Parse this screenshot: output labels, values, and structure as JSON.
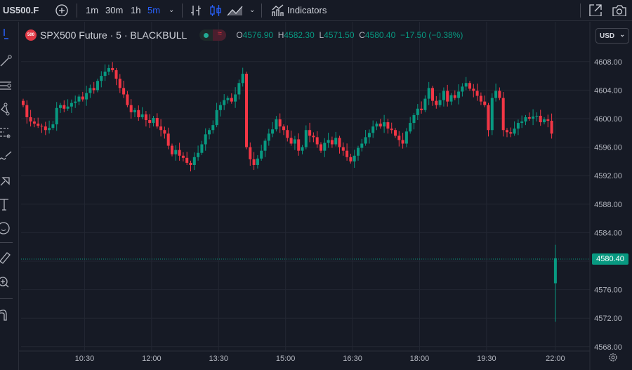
{
  "toolbar": {
    "symbol": "US500.F",
    "intervals": [
      "1m",
      "30m",
      "1h",
      "5m"
    ],
    "active_interval": "5m",
    "indicators_label": "Indicators"
  },
  "legend": {
    "title": "SPX500 Future · 5 · BLACKBULL",
    "badge": "500",
    "open_label": "O",
    "open": "4576.90",
    "high_label": "H",
    "high": "4582.30",
    "low_label": "L",
    "low": "4571.50",
    "close_label": "C",
    "close": "4580.40",
    "change": "−17.50 (−0.38%)"
  },
  "currency": "USD",
  "last_price_label": "4580.40",
  "colors": {
    "up": "#089981",
    "down": "#f23645",
    "bg": "#161a25",
    "grid": "#232733",
    "accent": "#2962ff"
  },
  "chart_data": {
    "type": "candlestick",
    "price_ticks": [
      "4608.00",
      "4604.00",
      "4600.00",
      "4596.00",
      "4592.00",
      "4588.00",
      "4584.00",
      "4580.00",
      "4576.00",
      "4572.00",
      "4568.00"
    ],
    "time_ticks": [
      {
        "label": "10:30",
        "bar": 16.5
      },
      {
        "label": "12:00",
        "bar": 34.5
      },
      {
        "label": "13:30",
        "bar": 52.5
      },
      {
        "label": "15:00",
        "bar": 70.5
      },
      {
        "label": "16:30",
        "bar": 88.5
      },
      {
        "label": "18:00",
        "bar": 106.5
      },
      {
        "label": "19:30",
        "bar": 124.5
      },
      {
        "label": "22:00",
        "bar": 143
      }
    ],
    "closes": [
      4601.9,
      4600.2,
      4599.6,
      4599.3,
      4599.0,
      4598.9,
      4598.4,
      4598.7,
      4599.2,
      4601.5,
      4601.9,
      4601.4,
      4601.7,
      4602.2,
      4602.4,
      4603.1,
      4602.7,
      4603.6,
      4604.3,
      4604.0,
      4605.3,
      4606.0,
      4606.6,
      4607.1,
      4606.8,
      4605.6,
      4604.3,
      4603.4,
      4601.9,
      4600.9,
      4601.2,
      4600.2,
      4600.6,
      4599.8,
      4599.4,
      4600.1,
      4598.9,
      4598.4,
      4597.9,
      4596.2,
      4595.0,
      4595.6,
      4594.8,
      4594.5,
      4593.8,
      4593.5,
      4594.6,
      4595.2,
      4596.4,
      4597.8,
      4598.4,
      4599.1,
      4601.2,
      4601.9,
      4602.6,
      4602.9,
      4602.4,
      4603.4,
      4605.0,
      4606.3,
      4596.0,
      4594.3,
      4593.5,
      4594.4,
      4595.5,
      4596.9,
      4597.9,
      4598.5,
      4599.9,
      4598.9,
      4598.4,
      4597.3,
      4596.5,
      4597.1,
      4595.5,
      4596.0,
      4598.4,
      4597.6,
      4597.4,
      4596.4,
      4595.5,
      4596.6,
      4597.0,
      4596.4,
      4597.3,
      4596.0,
      4595.5,
      4594.6,
      4594.0,
      4594.8,
      4595.9,
      4596.5,
      4597.4,
      4598.0,
      4598.9,
      4599.3,
      4598.9,
      4599.5,
      4598.6,
      4598.4,
      4597.6,
      4597.0,
      4596.5,
      4598.2,
      4599.4,
      4600.5,
      4601.4,
      4601.2,
      4602.8,
      4604.3,
      4602.5,
      4601.9,
      4602.6,
      4603.9,
      4602.4,
      4603.3,
      4602.9,
      4603.8,
      4604.5,
      4605.0,
      4604.2,
      4603.9,
      4603.2,
      4602.4,
      4601.9,
      4598.4,
      4602.9,
      4603.9,
      4602.9,
      4598.4,
      4598.1,
      4597.9,
      4598.6,
      4599.4,
      4599.6,
      4600.2,
      4600.0,
      4600.3,
      4600.4,
      4599.5,
      4599.9,
      4599.7,
      4597.9
    ],
    "last_bar": {
      "open": 4576.9,
      "high": 4582.3,
      "low": 4571.5,
      "close": 4580.4
    }
  }
}
